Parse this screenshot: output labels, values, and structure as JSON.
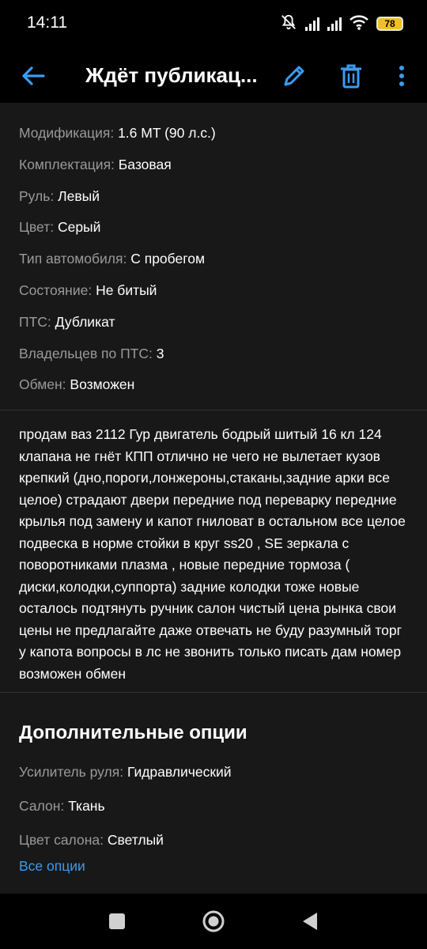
{
  "status": {
    "time": "14:11",
    "battery": "78"
  },
  "appbar": {
    "title": "Ждёт публикац..."
  },
  "specs": [
    {
      "label": "Модификация:",
      "value": "1.6 MT (90 л.с.)"
    },
    {
      "label": "Комплектация:",
      "value": "Базовая"
    },
    {
      "label": "Руль:",
      "value": "Левый"
    },
    {
      "label": "Цвет:",
      "value": "Серый"
    },
    {
      "label": "Тип автомобиля:",
      "value": "С пробегом"
    },
    {
      "label": "Состояние:",
      "value": "Не битый"
    },
    {
      "label": "ПТС:",
      "value": "Дубликат"
    },
    {
      "label": "Владельцев по ПТС:",
      "value": "3"
    },
    {
      "label": "Обмен:",
      "value": "Возможен"
    }
  ],
  "description": "продам ваз 2112 Гур двигатель бодрый шитый 16 кл 124 клапана не гнёт КПП отлично не чего не вылетает кузов крепкий (дно,пороги,лонжероны,стаканы,задние арки все целое) страдают двери передние под переварку передние крылья под замену и капот гниловат в остальном все целое подвеска в норме стойки в круг ss20 , SE зеркала с поворотниками плазма , новые передние тормоза ( диски,колодки,суппорта) задние колодки тоже новые осталось подтянуть ручник салон чистый цена рынка свои цены не предлагайте даже отвечать не буду разумный торг у капота вопросы в лс не звонить только писать дам номер возможен обмен",
  "extra": {
    "title": "Дополнительные опции",
    "options": [
      {
        "label": "Усилитель руля:",
        "value": "Гидравлический"
      },
      {
        "label": "Салон:",
        "value": "Ткань"
      },
      {
        "label": "Цвет салона:",
        "value": "Светлый"
      }
    ],
    "all_options_link": "Все опции"
  },
  "colors": {
    "accent": "#3b9cf0",
    "background": "#181818",
    "label": "#9a9a9a"
  }
}
